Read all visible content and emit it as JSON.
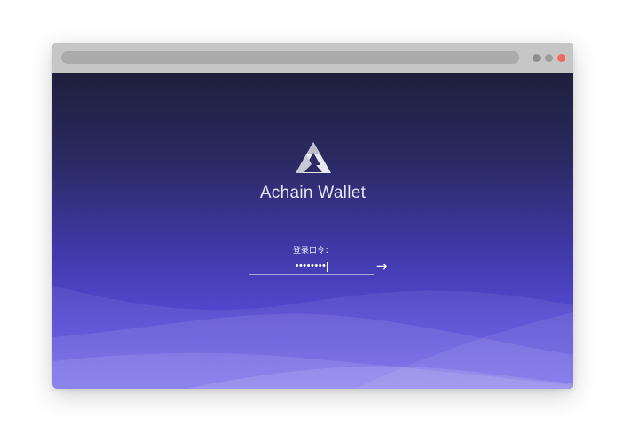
{
  "window": {
    "controls": [
      {
        "name": "minimize",
        "color": "#8f8f8f"
      },
      {
        "name": "maximize",
        "color": "#9c9c9c"
      },
      {
        "name": "close",
        "color": "#ee6a5f"
      }
    ]
  },
  "app": {
    "title": "Achain Wallet",
    "logo_icon": "triangle-logo-icon"
  },
  "login": {
    "label": "登录口令：",
    "password_mask": "••••••••",
    "submit_icon": "→"
  },
  "colors": {
    "gradient_top": "#1f1f3c",
    "gradient_bottom": "#6a5ee8",
    "titlebar": "#c6c6c6"
  }
}
